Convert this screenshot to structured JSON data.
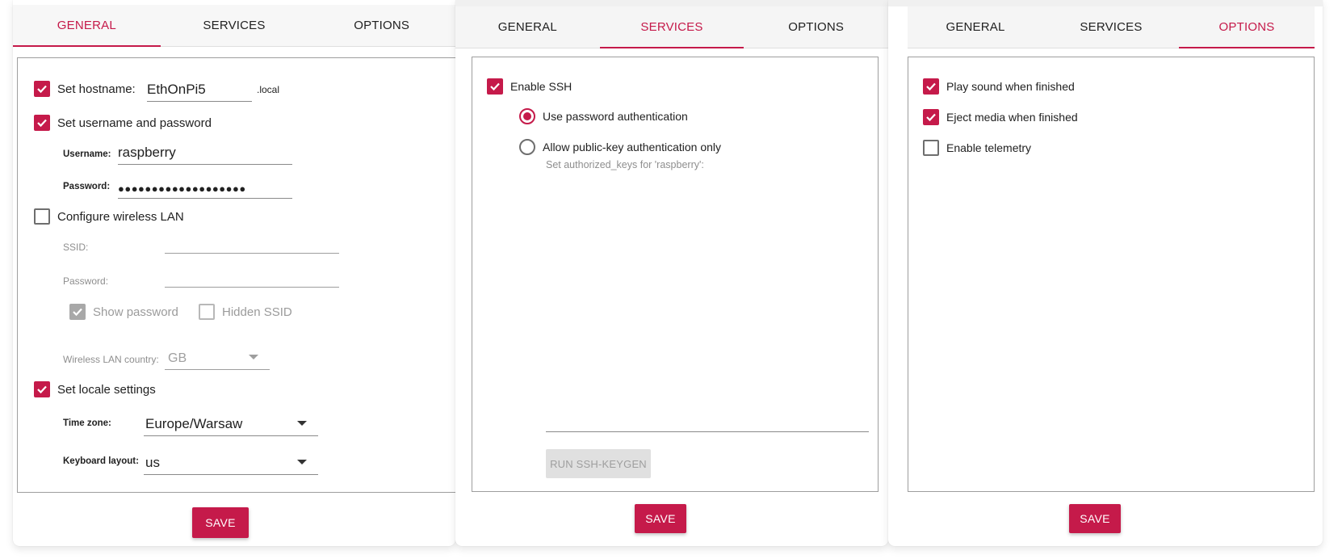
{
  "colors": {
    "accent": "#c51a4a",
    "disabled_gray": "#a8a8a8"
  },
  "panels": [
    {
      "tabs": [
        {
          "label": "GENERAL",
          "active": true
        },
        {
          "label": "SERVICES",
          "active": false
        },
        {
          "label": "OPTIONS",
          "active": false
        }
      ],
      "hostname": {
        "checked": true,
        "label": "Set hostname:",
        "value": "EthOnPi5",
        "suffix": ".local"
      },
      "user": {
        "checked": true,
        "label": "Set username and password",
        "username_label": "Username:",
        "username_value": "raspberry",
        "password_label": "Password:",
        "password_value": "●●●●●●●●●●●●●●●●●●●"
      },
      "wlan": {
        "checked": false,
        "label": "Configure wireless LAN",
        "ssid_label": "SSID:",
        "ssid_value": "",
        "password_label": "Password:",
        "password_value": "",
        "show_password": {
          "checked": true,
          "label": "Show password"
        },
        "hidden_ssid": {
          "checked": false,
          "label": "Hidden SSID"
        },
        "country_label": "Wireless LAN country:",
        "country_value": "GB"
      },
      "locale": {
        "checked": true,
        "label": "Set locale settings",
        "timezone_label": "Time zone:",
        "timezone_value": "Europe/Warsaw",
        "keyboard_label": "Keyboard layout:",
        "keyboard_value": "us"
      },
      "save_label": "SAVE"
    },
    {
      "tabs": [
        {
          "label": "GENERAL",
          "active": false
        },
        {
          "label": "SERVICES",
          "active": true
        },
        {
          "label": "OPTIONS",
          "active": false
        }
      ],
      "ssh": {
        "checked": true,
        "label": "Enable SSH",
        "password_auth": {
          "selected": true,
          "label": "Use password authentication"
        },
        "pubkey_auth": {
          "selected": false,
          "label": "Allow public-key authentication only"
        },
        "keys_label": "Set authorized_keys for 'raspberry':",
        "keygen_label": "RUN SSH-KEYGEN"
      },
      "save_label": "SAVE"
    },
    {
      "tabs": [
        {
          "label": "GENERAL",
          "active": false
        },
        {
          "label": "SERVICES",
          "active": false
        },
        {
          "label": "OPTIONS",
          "active": true
        }
      ],
      "options": [
        {
          "checked": true,
          "label": "Play sound when finished"
        },
        {
          "checked": true,
          "label": "Eject media when finished"
        },
        {
          "checked": false,
          "label": "Enable telemetry"
        }
      ],
      "save_label": "SAVE"
    }
  ]
}
